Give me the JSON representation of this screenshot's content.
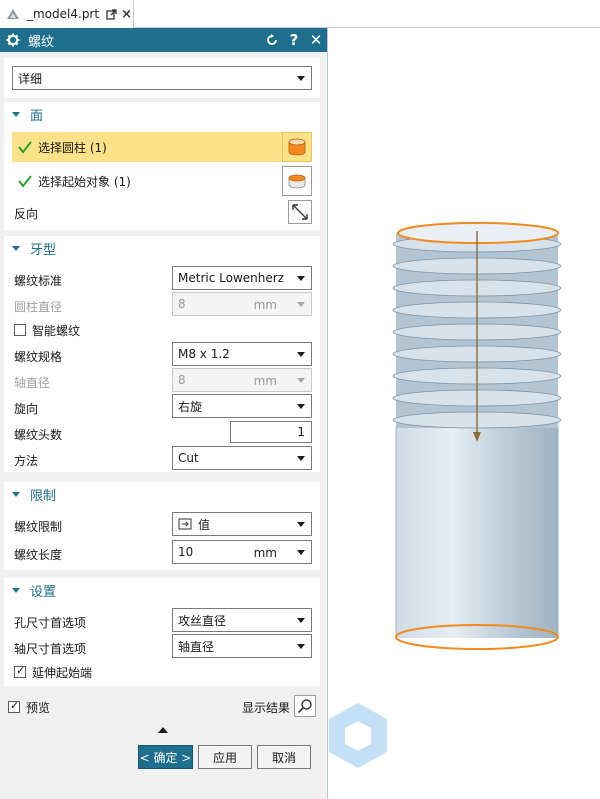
{
  "tab": {
    "title": "_model4.prt",
    "icon": "nx-part-icon"
  },
  "dialog": {
    "title": "螺纹",
    "reset_icon": "reset-icon",
    "help_label": "?",
    "close_label": "✕",
    "type_value": "详细",
    "face": {
      "header": "面",
      "select_cylinder": "选择圆柱 (1)",
      "select_start": "选择起始对象 (1)",
      "reverse": "反向"
    },
    "thread_form": {
      "header": "牙型",
      "standard_label": "螺纹标准",
      "standard_value": "Metric Lowenherz",
      "cyl_diameter_label": "圆柱直径",
      "cyl_diameter_value": "8",
      "cyl_diameter_unit": "mm",
      "smart_thread_label": "智能螺纹",
      "smart_thread_checked": false,
      "size_label": "螺纹规格",
      "size_value": "M8 x 1.2",
      "shaft_diameter_label": "轴直径",
      "shaft_diameter_value": "8",
      "shaft_diameter_unit": "mm",
      "handed_label": "旋向",
      "handed_value": "右旋",
      "starts_label": "螺纹头数",
      "starts_value": "1",
      "method_label": "方法",
      "method_value": "Cut"
    },
    "limits": {
      "header": "限制",
      "limit_label": "螺纹限制",
      "limit_value": "值",
      "length_label": "螺纹长度",
      "length_value": "10",
      "length_unit": "mm"
    },
    "settings": {
      "header": "设置",
      "hole_pref_label": "孔尺寸首选项",
      "hole_pref_value": "攻丝直径",
      "shaft_pref_label": "轴尺寸首选项",
      "shaft_pref_value": "轴直径",
      "extend_label": "延伸起始端",
      "extend_checked": true
    },
    "preview_label": "预览",
    "preview_checked": true,
    "show_result_label": "显示结果",
    "ok_label": "< 确定 >",
    "apply_label": "应用",
    "cancel_label": "取消"
  },
  "colors": {
    "title_bar": "#1d6f8d",
    "selection_highlight": "#fde28a",
    "edge_highlight": "#f28a1e"
  }
}
